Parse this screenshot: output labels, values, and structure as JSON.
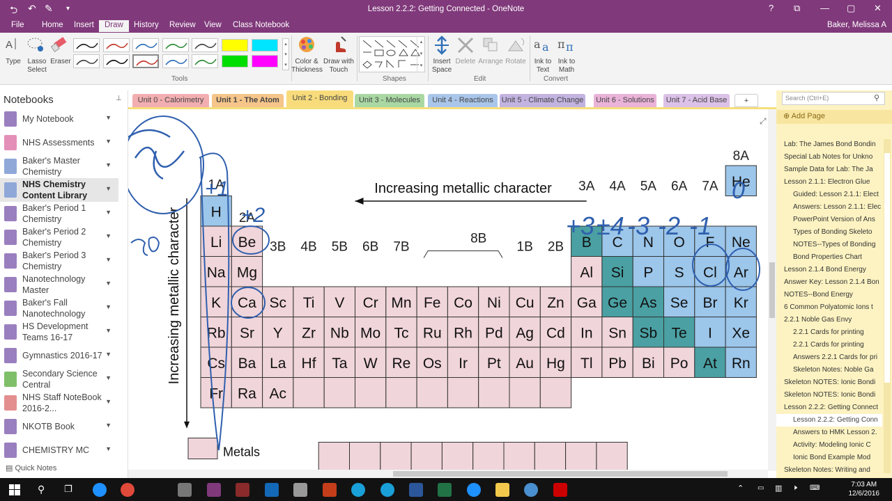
{
  "window": {
    "title": "Lesson 2.2.2: Getting Connected - OneNote",
    "controls": [
      "?",
      "⧉",
      "—",
      "▢",
      "✕"
    ]
  },
  "quick_access": {
    "back": "⮌",
    "undo": "↶",
    "pen": "✎"
  },
  "menu": {
    "items": [
      "File",
      "Home",
      "Insert",
      "Draw",
      "History",
      "Review",
      "View",
      "Class Notebook"
    ],
    "active": "Draw",
    "user": "Baker, Melissa A"
  },
  "ribbon": {
    "type": "Type",
    "lasso": "Lasso Select",
    "eraser": "Eraser",
    "tools_label": "Tools",
    "color_thickness": "Color & Thickness",
    "draw_touch": "Draw with Touch",
    "shapes_label": "Shapes",
    "insert_space": "Insert Space",
    "delete": "Delete",
    "arrange": "Arrange",
    "rotate": "Rotate",
    "edit_label": "Edit",
    "ink_text": "Ink to Text",
    "ink_math": "Ink to Math",
    "convert_label": "Convert",
    "pen_colors": [
      "#222222",
      "#c0392b",
      "#2e6fb8",
      "#2e8b3a",
      "#444444",
      "#444444",
      "#111111",
      "#c0392b",
      "#2e6fb8",
      "#2e8b3a",
      "#333333",
      "#00cc00"
    ],
    "highlighters": [
      "#ffff00",
      "#00e5ff",
      "#00dd00",
      "#ff00ff"
    ]
  },
  "sidebar": {
    "header": "Notebooks",
    "notebooks": [
      {
        "label": "My Notebook",
        "color": "#9a7fbf"
      },
      {
        "label": "NHS Assessments",
        "color": "#e48fb8"
      },
      {
        "label": "Baker's Master Chemistry",
        "color": "#8fa8d8"
      },
      {
        "label": "NHS Chemistry Content Library",
        "color": "#8fa8d8"
      },
      {
        "label": "Baker's Period 1 Chemistry",
        "color": "#9a7fbf"
      },
      {
        "label": "Baker's Period 2 Chemistry",
        "color": "#9a7fbf"
      },
      {
        "label": "Baker's Period 3 Chemistry",
        "color": "#9a7fbf"
      },
      {
        "label": "Nanotechnology Master",
        "color": "#9a7fbf"
      },
      {
        "label": "Baker's Fall Nanotechnology",
        "color": "#9a7fbf"
      },
      {
        "label": "HS Development Teams 16-17",
        "color": "#9a7fbf"
      },
      {
        "label": "Gymnastics 2016-17",
        "color": "#9a7fbf"
      },
      {
        "label": "Secondary Science Central",
        "color": "#7fbf6a"
      },
      {
        "label": "NHS Staff NoteBook 2016-2...",
        "color": "#e48f8f"
      },
      {
        "label": "NKOTB Book",
        "color": "#9a7fbf"
      },
      {
        "label": "CHEMISTRY MC",
        "color": "#9a7fbf"
      }
    ],
    "quick_notes": "Quick Notes"
  },
  "tabs": [
    {
      "label": "Unit 0 - Calorimetry",
      "color": "#f2aeb0"
    },
    {
      "label": "Unit 1 - The Atom",
      "color": "#f5c58a"
    },
    {
      "label": "Unit 2 - Bonding",
      "color": "#f8dc7c"
    },
    {
      "label": "Unit 3 - Molecules",
      "color": "#a9d8a3"
    },
    {
      "label": "Unit 4 - Reactions",
      "color": "#a9c6ea"
    },
    {
      "label": "Unit 5 - Climate Change",
      "color": "#c2b3e0"
    },
    {
      "label": "Unit 6 - Solutions",
      "color": "#eab3d8"
    },
    {
      "label": "Unit 7 - Acid Base",
      "color": "#dcc1e8"
    },
    {
      "label": "+",
      "color": "#ffffff"
    }
  ],
  "right": {
    "search": "Search (Ctrl+E)",
    "add_page": "Add Page",
    "pages": [
      {
        "label": "Lab: The James Bond Bondin",
        "indent": 0
      },
      {
        "label": "Special Lab Notes for Unkno",
        "indent": 0
      },
      {
        "label": "Sample Data for Lab: The Ja",
        "indent": 0
      },
      {
        "label": "Lesson 2.1.1: Electron Glue",
        "indent": 0
      },
      {
        "label": "Guided: Lesson 2.1.1: Elect",
        "indent": 1
      },
      {
        "label": "Answers: Lesson 2.1.1: Elec",
        "indent": 1
      },
      {
        "label": "PowerPoint Version of Ans",
        "indent": 1
      },
      {
        "label": "Types of Bonding Skeleto",
        "indent": 1
      },
      {
        "label": "NOTES--Types of Bonding",
        "indent": 1
      },
      {
        "label": "Bond Properties Chart",
        "indent": 1
      },
      {
        "label": "Lesson 2.1.4 Bond Energy",
        "indent": 0
      },
      {
        "label": "Answer Key: Lesson 2.1.4 Bon",
        "indent": 0
      },
      {
        "label": "NOTES--Bond Energy",
        "indent": 0
      },
      {
        "label": "6 Common Polyatomic Ions t",
        "indent": 0
      },
      {
        "label": "2.2.1 Noble Gas Envy",
        "indent": 0
      },
      {
        "label": "2.2.1 Cards for printing",
        "indent": 1
      },
      {
        "label": "2.2.1 Cards for printing",
        "indent": 1
      },
      {
        "label": "Answers 2.2.1 Cards for pri",
        "indent": 1
      },
      {
        "label": "Skeleton Notes: Noble Ga",
        "indent": 1
      },
      {
        "label": "Skeleton NOTES: Ionic Bondi",
        "indent": 0
      },
      {
        "label": "Skeleton NOTES: Ionic Bondi",
        "indent": 0
      },
      {
        "label": "Lesson 2.2.2: Getting Connect",
        "indent": 0
      },
      {
        "label": "Lesson 2.2.2: Getting Conn",
        "indent": 1
      },
      {
        "label": "Answers to HMK Lesson 2.",
        "indent": 1
      },
      {
        "label": "Activity: Modeling Ionic C",
        "indent": 1
      },
      {
        "label": "Ionic Bond Example Mod",
        "indent": 1
      },
      {
        "label": "Skeleton Notes: Writing and",
        "indent": 0
      }
    ],
    "selected_index": 22
  },
  "periodic": {
    "horiz_label": "Increasing metallic character",
    "vert_label": "Increasing metallic character",
    "group_labels": {
      "1A": "1A",
      "2A": "2A",
      "3A": "3A",
      "4A": "4A",
      "5A": "5A",
      "6A": "6A",
      "7A": "7A",
      "8A": "8A",
      "3B": "3B",
      "4B": "4B",
      "5B": "5B",
      "6B": "6B",
      "7B": "7B",
      "8B": "8B",
      "1B": "1B",
      "2B": "2B"
    },
    "colors": {
      "metal": "#f0d5da",
      "nonmetal": "#9cc6ea",
      "metalloid": "#4aa0a3"
    },
    "rows": [
      [
        [
          "H",
          "nonmetal"
        ]
      ],
      [
        [
          "Li",
          "metal"
        ],
        [
          "Be",
          "metal"
        ],
        [
          "B",
          "metalloid"
        ],
        [
          "C",
          "nonmetal"
        ],
        [
          "N",
          "nonmetal"
        ],
        [
          "O",
          "nonmetal"
        ],
        [
          "F",
          "nonmetal"
        ],
        [
          "Ne",
          "nonmetal"
        ],
        [
          "He",
          "nonmetal"
        ]
      ],
      [
        [
          "Na",
          "metal"
        ],
        [
          "Mg",
          "metal"
        ],
        [
          "Al",
          "metal"
        ],
        [
          "Si",
          "metalloid"
        ],
        [
          "P",
          "nonmetal"
        ],
        [
          "S",
          "nonmetal"
        ],
        [
          "Cl",
          "nonmetal"
        ],
        [
          "Ar",
          "nonmetal"
        ]
      ],
      [
        [
          "K",
          "metal"
        ],
        [
          "Ca",
          "metal"
        ],
        [
          "Sc",
          "metal"
        ],
        [
          "Ti",
          "metal"
        ],
        [
          "V",
          "metal"
        ],
        [
          "Cr",
          "metal"
        ],
        [
          "Mn",
          "metal"
        ],
        [
          "Fe",
          "metal"
        ],
        [
          "Co",
          "metal"
        ],
        [
          "Ni",
          "metal"
        ],
        [
          "Cu",
          "metal"
        ],
        [
          "Zn",
          "metal"
        ],
        [
          "Ga",
          "metal"
        ],
        [
          "Ge",
          "metalloid"
        ],
        [
          "As",
          "metalloid"
        ],
        [
          "Se",
          "nonmetal"
        ],
        [
          "Br",
          "nonmetal"
        ],
        [
          "Kr",
          "nonmetal"
        ]
      ],
      [
        [
          "Rb",
          "metal"
        ],
        [
          "Sr",
          "metal"
        ],
        [
          "Y",
          "metal"
        ],
        [
          "Zr",
          "metal"
        ],
        [
          "Nb",
          "metal"
        ],
        [
          "Mo",
          "metal"
        ],
        [
          "Tc",
          "metal"
        ],
        [
          "Ru",
          "metal"
        ],
        [
          "Rh",
          "metal"
        ],
        [
          "Pd",
          "metal"
        ],
        [
          "Ag",
          "metal"
        ],
        [
          "Cd",
          "metal"
        ],
        [
          "In",
          "metal"
        ],
        [
          "Sn",
          "metal"
        ],
        [
          "Sb",
          "metalloid"
        ],
        [
          "Te",
          "metalloid"
        ],
        [
          "I",
          "nonmetal"
        ],
        [
          "Xe",
          "nonmetal"
        ]
      ],
      [
        [
          "Cs",
          "metal"
        ],
        [
          "Ba",
          "metal"
        ],
        [
          "La",
          "metal"
        ],
        [
          "Hf",
          "metal"
        ],
        [
          "Ta",
          "metal"
        ],
        [
          "W",
          "metal"
        ],
        [
          "Re",
          "metal"
        ],
        [
          "Os",
          "metal"
        ],
        [
          "Ir",
          "metal"
        ],
        [
          "Pt",
          "metal"
        ],
        [
          "Au",
          "metal"
        ],
        [
          "Hg",
          "metal"
        ],
        [
          "Tl",
          "metal"
        ],
        [
          "Pb",
          "metal"
        ],
        [
          "Bi",
          "metal"
        ],
        [
          "Po",
          "metal"
        ],
        [
          "At",
          "metalloid"
        ],
        [
          "Rn",
          "nonmetal"
        ]
      ],
      [
        [
          "Fr",
          "metal"
        ],
        [
          "Ra",
          "metal"
        ],
        [
          "Ac",
          "metal"
        ]
      ]
    ],
    "bottom_legend": "Metals"
  },
  "ink": {
    "charges": [
      "+1",
      "+2",
      "+3",
      "±4",
      "-3",
      "-2",
      "-1",
      "0"
    ],
    "color": "#2f5fae"
  },
  "clock": {
    "time": "7:03 AM",
    "date": "12/6/2016"
  }
}
